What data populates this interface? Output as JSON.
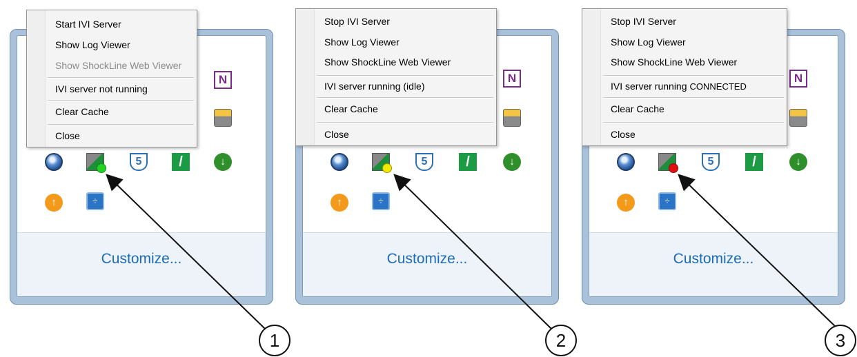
{
  "panels": [
    {
      "menu": {
        "items": [
          {
            "label": "Start IVI Server",
            "enabled": true
          },
          {
            "label": "Show Log Viewer",
            "enabled": true
          },
          {
            "label": "Show ShockLine Web Viewer",
            "enabled": false
          }
        ],
        "status": {
          "label": "IVI server not running",
          "extra": ""
        },
        "clear_cache": "Clear Cache",
        "close": "Close"
      },
      "status_dot_color": "#22d322",
      "customize": "Customize...",
      "callout": "1"
    },
    {
      "menu": {
        "items": [
          {
            "label": "Stop IVI Server",
            "enabled": true
          },
          {
            "label": "Show Log Viewer",
            "enabled": true
          },
          {
            "label": "Show ShockLine Web Viewer",
            "enabled": true
          }
        ],
        "status": {
          "label": "IVI server running (idle)",
          "extra": ""
        },
        "clear_cache": "Clear Cache",
        "close": "Close"
      },
      "status_dot_color": "#f2ea00",
      "customize": "Customize...",
      "callout": "2"
    },
    {
      "menu": {
        "items": [
          {
            "label": "Stop IVI Server",
            "enabled": true
          },
          {
            "label": "Show Log Viewer",
            "enabled": true
          },
          {
            "label": "Show ShockLine Web Viewer",
            "enabled": true
          }
        ],
        "status": {
          "label": "IVI server running",
          "extra": "CONNECTED"
        },
        "clear_cache": "Clear Cache",
        "close": "Close"
      },
      "status_dot_color": "#e01010",
      "customize": "Customize...",
      "callout": "3"
    }
  ],
  "tray_icons": [
    "ie-icon",
    "ivi-server-icon",
    "s5-shield-icon",
    "z-app-icon",
    "download-icon",
    "update-icon",
    "calculator-icon"
  ],
  "hidden_icons": [
    "onenote-icon",
    "printer-icon"
  ],
  "onenote_glyph": "N"
}
